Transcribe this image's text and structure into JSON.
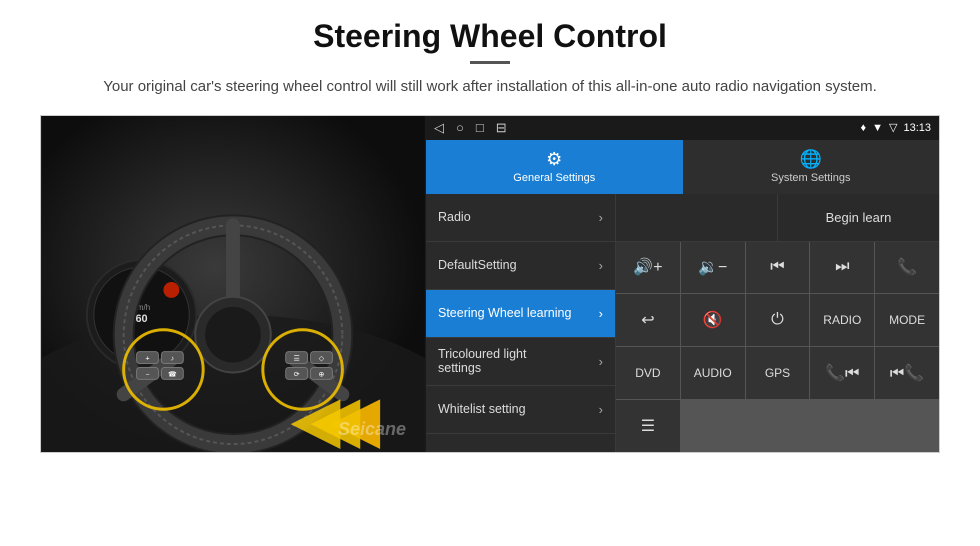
{
  "page": {
    "title": "Steering Wheel Control",
    "subtitle": "Your original car's steering wheel control will still work after installation of this all-in-one auto radio navigation system.",
    "divider": true
  },
  "status_bar": {
    "nav_back": "◁",
    "nav_home": "○",
    "nav_recent": "□",
    "nav_app": "⊟",
    "signal_icon": "▼",
    "wifi_icon": "▽",
    "time": "13:13"
  },
  "tabs": [
    {
      "id": "general",
      "label": "General Settings",
      "icon": "⚙",
      "active": true
    },
    {
      "id": "system",
      "label": "System Settings",
      "icon": "🌐",
      "active": false
    }
  ],
  "menu_items": [
    {
      "label": "Radio",
      "active": false
    },
    {
      "label": "DefaultSetting",
      "active": false
    },
    {
      "label": "Steering Wheel learning",
      "active": true
    },
    {
      "label": "Tricoloured light settings",
      "active": false
    },
    {
      "label": "Whitelist setting",
      "active": false
    }
  ],
  "controls": {
    "begin_learn_label": "Begin learn",
    "buttons": [
      {
        "label": "🔊+",
        "row": 0,
        "col": 0
      },
      {
        "label": "🔊−",
        "row": 0,
        "col": 1
      },
      {
        "label": "⏮",
        "row": 0,
        "col": 2
      },
      {
        "label": "⏭",
        "row": 0,
        "col": 3
      },
      {
        "label": "📞",
        "row": 0,
        "col": 4
      },
      {
        "label": "↩",
        "row": 1,
        "col": 0
      },
      {
        "label": "🔇",
        "row": 1,
        "col": 1
      },
      {
        "label": "⏻",
        "row": 1,
        "col": 2
      },
      {
        "label": "RADIO",
        "row": 1,
        "col": 3
      },
      {
        "label": "MODE",
        "row": 1,
        "col": 4
      },
      {
        "label": "DVD",
        "row": 2,
        "col": 0
      },
      {
        "label": "AUDIO",
        "row": 2,
        "col": 1
      },
      {
        "label": "GPS",
        "row": 2,
        "col": 2
      },
      {
        "label": "📞⏮",
        "row": 2,
        "col": 3
      },
      {
        "label": "⏮📞",
        "row": 2,
        "col": 4
      },
      {
        "label": "🗂",
        "row": 3,
        "col": 0
      }
    ]
  },
  "watermark": "Seicane"
}
